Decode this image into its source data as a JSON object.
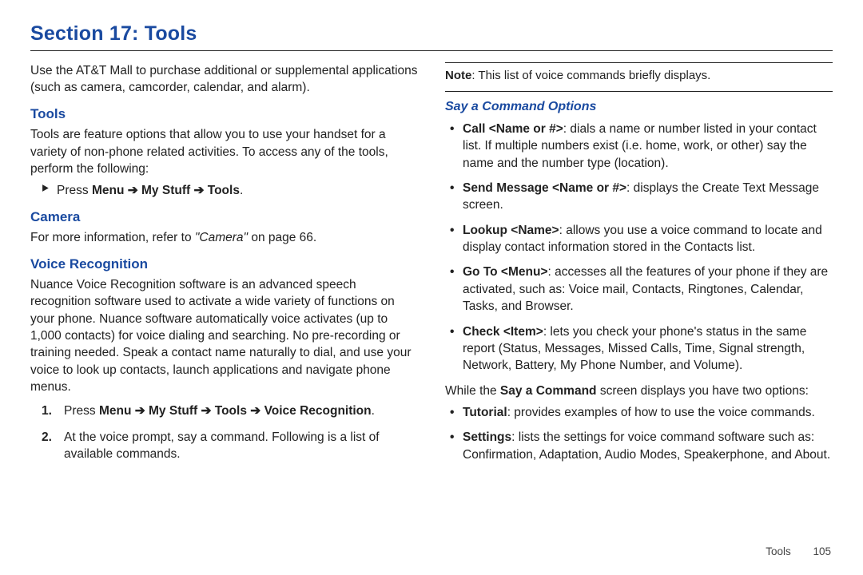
{
  "section_title": "Section 17: Tools",
  "left": {
    "intro": "Use the AT&T Mall to purchase additional or supplemental applications (such as camera, camcorder, calendar, and alarm).",
    "tools_heading": "Tools",
    "tools_body": "Tools are feature options that allow you to use your handset for a variety of non-phone related activities. To access any of the tools, perform the following:",
    "press_prefix": "Press ",
    "menu_word": "Menu",
    "mystuff_word": "My Stuff",
    "tools_word": "Tools",
    "vr_word": "Voice Recognition",
    "arrow": " ➔ ",
    "period": ".",
    "camera_heading": "Camera",
    "camera_body_pre": "For more information, refer to ",
    "camera_ref": "\"Camera\"",
    "camera_body_post": "  on page 66.",
    "vr_heading": "Voice Recognition",
    "vr_body": "Nuance Voice Recognition software is an advanced speech recognition software used to activate a wide variety of functions on your phone. Nuance software automatically voice activates (up to 1,000 contacts) for voice dialing and searching. No pre-recording or training needed. Speak a contact name naturally to dial, and use your voice to look up contacts, launch applications and navigate phone menus.",
    "step2": "At the voice prompt, say a command. Following is a list of available commands."
  },
  "right": {
    "note_label": "Note",
    "note_sep": ": ",
    "note_text": "This list of voice commands briefly displays.",
    "say_heading": "Say a Command Options",
    "commands": {
      "call": {
        "title": "Call <Name or #>",
        "desc": ": dials a name or number listed in your contact list. If multiple numbers exist (i.e. home, work, or other) say the name and the number type (location)."
      },
      "send": {
        "title": "Send Message <Name or #>",
        "desc": ": displays the Create Text Message screen."
      },
      "lookup": {
        "title": "Lookup <Name>",
        "desc": ": allows you use a voice command to locate and display contact information stored in the Contacts list."
      },
      "goto": {
        "title": "Go To <Menu>",
        "desc": ": accesses all the features of your phone if they are activated, such as: Voice mail, Contacts, Ringtones, Calendar, Tasks, and Browser."
      },
      "check": {
        "title": "Check <Item>",
        "desc": ": lets you check your phone's status in the same report (Status, Messages, Missed Calls, Time, Signal strength, Network, Battery, My Phone Number, and Volume)."
      }
    },
    "while_pre": "While the ",
    "while_bold": "Say a Command",
    "while_post": " screen displays you have two options:",
    "opts": {
      "tutorial": {
        "title": "Tutorial",
        "desc": ": provides examples of how to use the voice commands."
      },
      "settings": {
        "title": "Settings",
        "desc": ": lists the settings for voice command software such as: Confirmation, Adaptation, Audio Modes, Speakerphone, and About."
      }
    }
  },
  "footer": {
    "section": "Tools",
    "page": "105"
  }
}
